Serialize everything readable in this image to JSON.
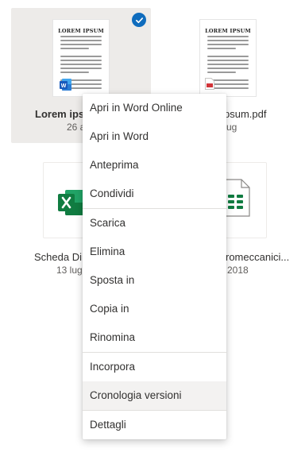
{
  "files": [
    {
      "name": "Lorem ips",
      "date": "26 a",
      "thumb_title": "LOREM IPSUM",
      "type_icon": "word-icon",
      "selected": true
    },
    {
      "name": "psum.pdf",
      "date": "ug",
      "thumb_title": "LOREM IPSUM",
      "type_icon": "pdf-icon"
    },
    {
      "name": "Scheda Di",
      "date": "13 lug",
      "type_icon": "excel-icon"
    },
    {
      "name": "romeccanici...",
      "date": "2018",
      "type_icon": "spreadsheet-icon"
    }
  ],
  "context_menu": {
    "groups": [
      [
        "Apri in Word Online",
        "Apri in Word",
        "Anteprima",
        "Condividi"
      ],
      [
        "Scarica",
        "Elimina",
        "Sposta in",
        "Copia in",
        "Rinomina"
      ],
      [
        "Incorpora",
        "Cronologia versioni",
        "Dettagli"
      ]
    ],
    "hovered_item": "Cronologia versioni"
  },
  "colors": {
    "selection_bg": "#edebe9",
    "check_blue": "#0f6cbd",
    "word_blue": "#185abd",
    "excel_green": "#107c41",
    "pdf_red": "#d13438",
    "menu_hover": "#f3f2f1"
  }
}
